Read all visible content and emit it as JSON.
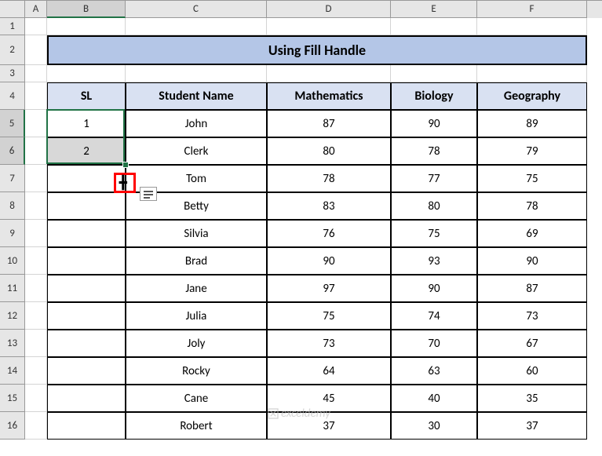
{
  "cols": {
    "A": "A",
    "B": "B",
    "C": "C",
    "D": "D",
    "E": "E",
    "F": "F"
  },
  "title": "Using Fill Handle",
  "headers": {
    "sl": "SL",
    "name": "Student Name",
    "math": "Mathematics",
    "bio": "Biology",
    "geo": "Geography"
  },
  "data": [
    {
      "sl": "1",
      "name": "John",
      "math": "87",
      "bio": "90",
      "geo": "89"
    },
    {
      "sl": "2",
      "name": "Clerk",
      "math": "80",
      "bio": "78",
      "geo": "79"
    },
    {
      "sl": "",
      "name": "Tom",
      "math": "78",
      "bio": "77",
      "geo": "75"
    },
    {
      "sl": "",
      "name": "Betty",
      "math": "83",
      "bio": "80",
      "geo": "78"
    },
    {
      "sl": "",
      "name": "Silvia",
      "math": "76",
      "bio": "75",
      "geo": "69"
    },
    {
      "sl": "",
      "name": "Brad",
      "math": "90",
      "bio": "93",
      "geo": "90"
    },
    {
      "sl": "",
      "name": "Jane",
      "math": "97",
      "bio": "90",
      "geo": "87"
    },
    {
      "sl": "",
      "name": "Julia",
      "math": "75",
      "bio": "74",
      "geo": "73"
    },
    {
      "sl": "",
      "name": "Joly",
      "math": "73",
      "bio": "70",
      "geo": "67"
    },
    {
      "sl": "",
      "name": "Rocky",
      "math": "64",
      "bio": "63",
      "geo": "60"
    },
    {
      "sl": "",
      "name": "Cane",
      "math": "45",
      "bio": "40",
      "geo": "35"
    },
    {
      "sl": "",
      "name": "Robert",
      "math": "37",
      "bio": "30",
      "geo": "37"
    }
  ],
  "rows": [
    "1",
    "2",
    "3",
    "4",
    "5",
    "6",
    "7",
    "8",
    "9",
    "10",
    "11",
    "12",
    "13",
    "14",
    "15",
    "16"
  ],
  "watermark": "exceldemy"
}
